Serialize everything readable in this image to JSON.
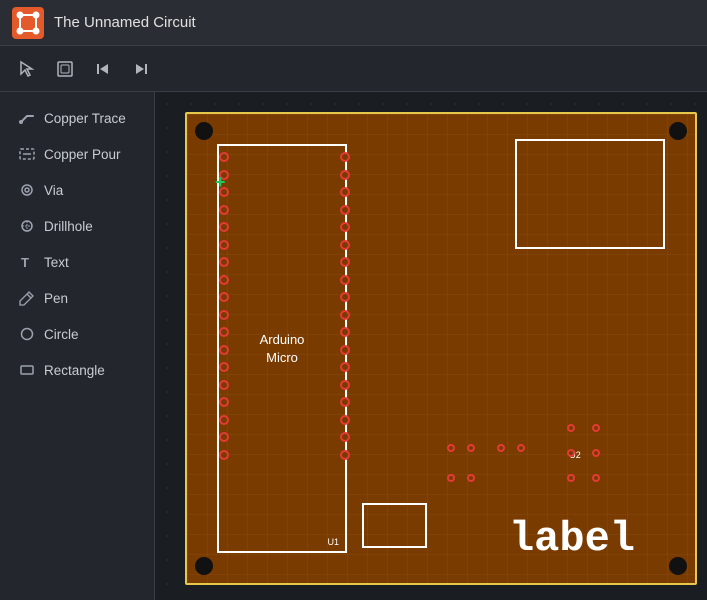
{
  "titleBar": {
    "appTitle": "The Unnamed Circuit"
  },
  "toolbar": {
    "buttons": [
      {
        "name": "selection-tool",
        "icon": "⬡",
        "label": "Selection"
      },
      {
        "name": "frame-tool",
        "icon": "▭",
        "label": "Frame"
      },
      {
        "name": "step-back",
        "icon": "◀",
        "label": "Step Back"
      },
      {
        "name": "step-forward",
        "icon": "▶",
        "label": "Step Forward"
      }
    ]
  },
  "sidebar": {
    "items": [
      {
        "name": "copper-trace",
        "label": "Copper Trace",
        "icon": "trace"
      },
      {
        "name": "copper-pour",
        "label": "Copper Pour",
        "icon": "pour"
      },
      {
        "name": "via",
        "label": "Via",
        "icon": "via"
      },
      {
        "name": "drillhole",
        "label": "Drillhole",
        "icon": "drill"
      },
      {
        "name": "text",
        "label": "Text",
        "icon": "text"
      },
      {
        "name": "pen",
        "label": "Pen",
        "icon": "pen"
      },
      {
        "name": "circle",
        "label": "Circle",
        "icon": "circle"
      },
      {
        "name": "rectangle",
        "label": "Rectangle",
        "icon": "rect"
      }
    ]
  },
  "canvas": {
    "arduinoLabel": "Arduino\nMicro",
    "arduinoRef": "U1",
    "u2Ref": "U2",
    "boardLabel": "label",
    "crosshairColor": "#22c55e"
  },
  "colors": {
    "accent": "#e6c84a",
    "board": "#7a3b00",
    "background": "#1a1d22",
    "sidebar": "#23262c",
    "titlebar": "#2a2d33"
  }
}
